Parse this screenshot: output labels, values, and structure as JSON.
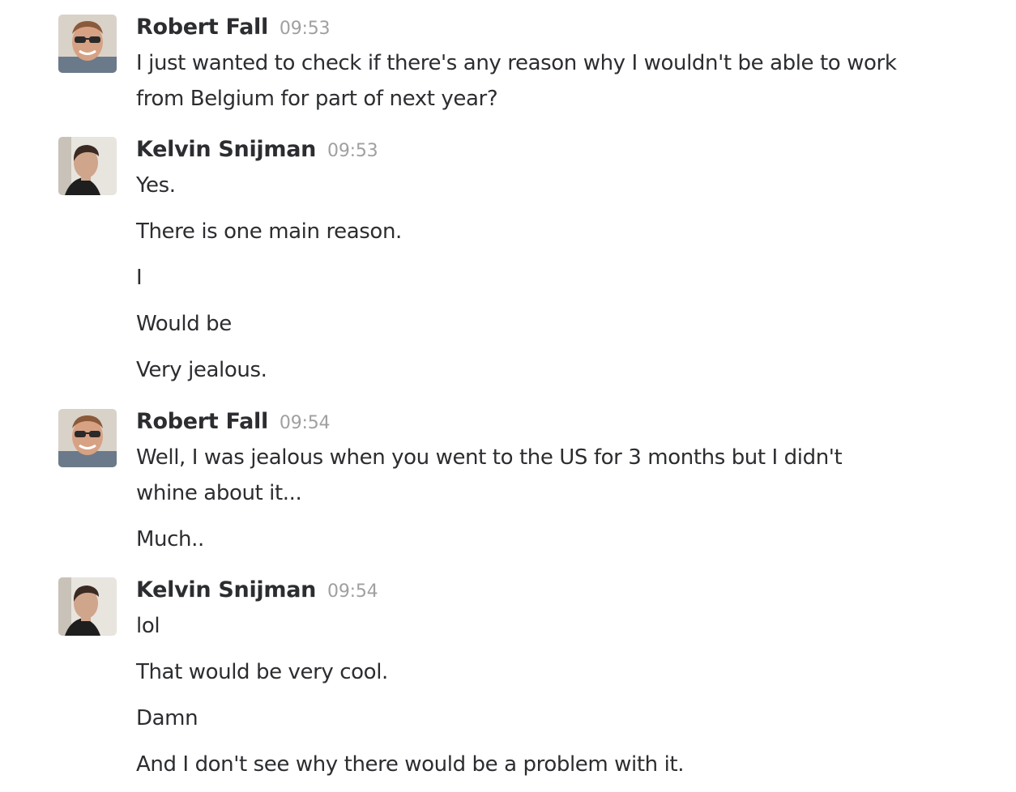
{
  "messages": [
    {
      "author": "Robert Fall",
      "time": "09:53",
      "avatar": "avatar-robert-fall",
      "lines": [
        "I just wanted to check if there's any reason why I wouldn't be able to work from Belgium for part of next year?"
      ]
    },
    {
      "author": "Kelvin Snijman",
      "time": "09:53",
      "avatar": "avatar-kelvin-snijman",
      "lines": [
        "Yes.",
        "There is one main reason.",
        "I",
        "Would be",
        "Very jealous."
      ]
    },
    {
      "author": "Robert Fall",
      "time": "09:54",
      "avatar": "avatar-robert-fall",
      "lines": [
        "Well, I was jealous when you went to the US for 3 months but I didn't whine about it...",
        "Much.."
      ]
    },
    {
      "author": "Kelvin Snijman",
      "time": "09:54",
      "avatar": "avatar-kelvin-snijman",
      "lines": [
        "lol",
        "That would be very cool.",
        "Damn",
        "And I don't see why there would be a problem with it."
      ]
    }
  ]
}
